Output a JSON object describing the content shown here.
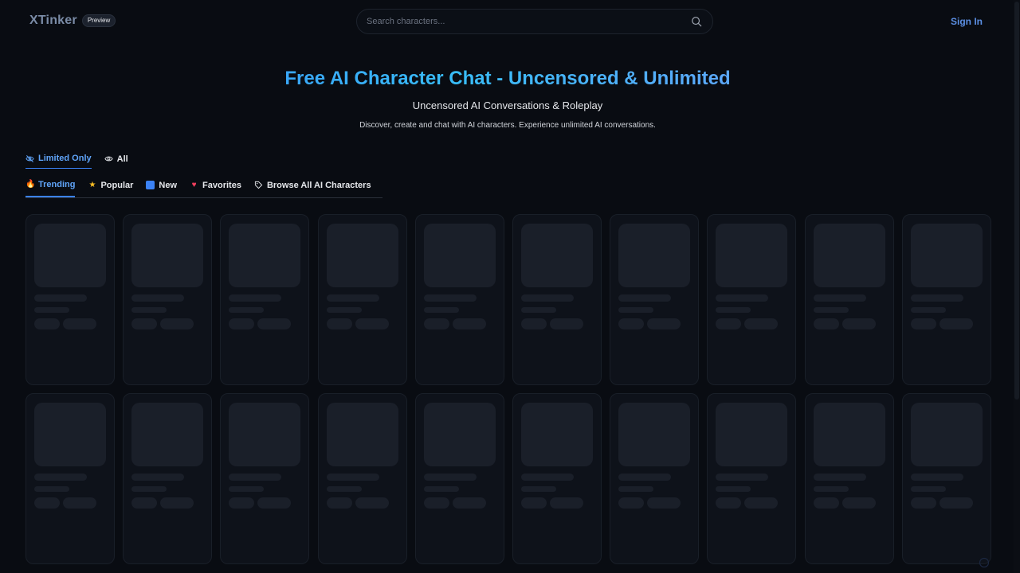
{
  "header": {
    "logo": "XTinker",
    "badge": "Preview",
    "search_placeholder": "Search characters...",
    "sign_in": "Sign In"
  },
  "hero": {
    "title": "Free AI Character Chat - Uncensored & Unlimited",
    "subtitle": "Uncensored AI Conversations & Roleplay",
    "description": "Discover, create and chat with AI characters. Experience unlimited AI conversations."
  },
  "filters": [
    {
      "label": "Limited Only",
      "icon": "eye-off-icon",
      "active": true
    },
    {
      "label": "All",
      "icon": "eye-icon",
      "active": false
    }
  ],
  "categories": [
    {
      "label": "Trending",
      "icon": "fire-icon",
      "active": true
    },
    {
      "label": "Popular",
      "icon": "star-icon",
      "active": false
    },
    {
      "label": "New",
      "icon": "new-icon",
      "active": false
    },
    {
      "label": "Favorites",
      "icon": "heart-icon",
      "active": false
    },
    {
      "label": "Browse All AI Characters",
      "icon": "tag-icon",
      "active": false
    }
  ],
  "skeleton": {
    "rows": 2,
    "columns": 10
  },
  "colors": {
    "accent": "#3b82f6",
    "background": "#090c12",
    "skeleton": "#1a1f29"
  }
}
